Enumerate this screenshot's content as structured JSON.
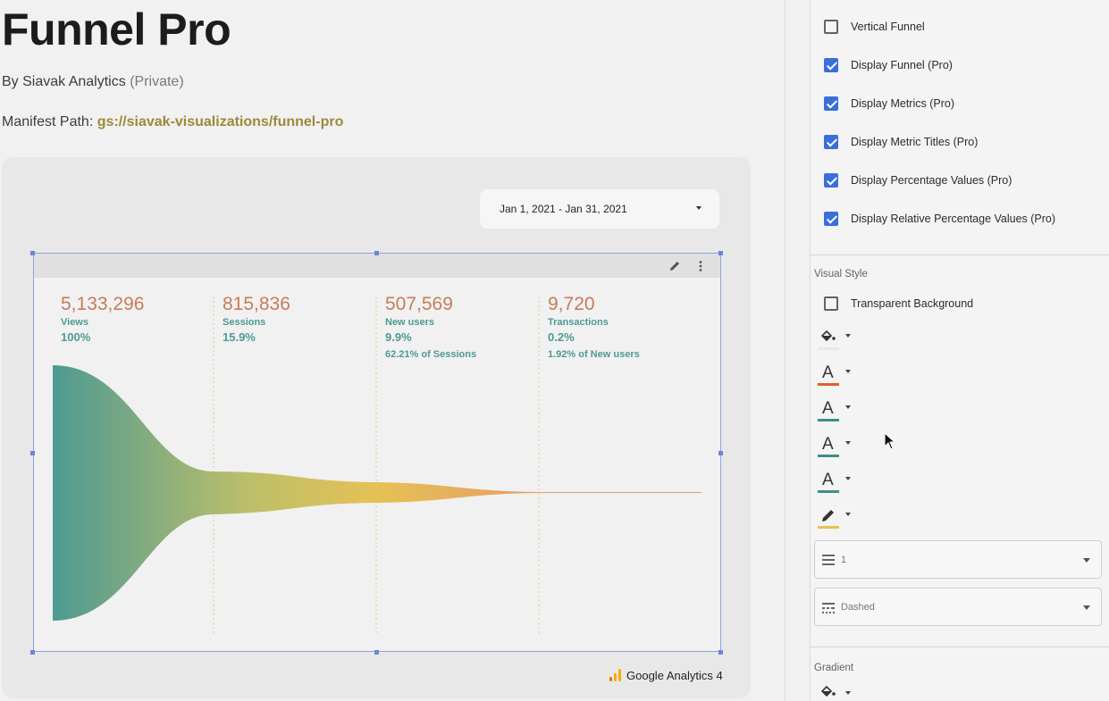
{
  "page": {
    "title": "Funnel Pro",
    "byline_prefix": "By Siavak Analytics",
    "byline_visibility": "(Private)",
    "manifest_label": "Manifest Path:",
    "manifest_path": "gs://siavak-visualizations/funnel-pro"
  },
  "preview": {
    "date_range": "Jan 1, 2021 - Jan 31, 2021",
    "data_source": "Google Analytics 4",
    "metrics": [
      {
        "value": "5,133,296",
        "label": "Views",
        "percent": "100%",
        "relative": ""
      },
      {
        "value": "815,836",
        "label": "Sessions",
        "percent": "15.9%",
        "relative": ""
      },
      {
        "value": "507,569",
        "label": "New users",
        "percent": "9.9%",
        "relative": "62.21% of Sessions"
      },
      {
        "value": "9,720",
        "label": "Transactions",
        "percent": "0.2%",
        "relative": "1.92% of New users"
      }
    ],
    "colors": {
      "teal": "#4e9a92",
      "gold": "#e6c155",
      "orange": "#e7a063",
      "value_text": "#c67d5a"
    }
  },
  "settings": {
    "checkboxes": [
      {
        "label": "Vertical Funnel",
        "checked": false
      },
      {
        "label": "Display Funnel (Pro)",
        "checked": true
      },
      {
        "label": "Display Metrics (Pro)",
        "checked": true
      },
      {
        "label": "Display Metric Titles (Pro)",
        "checked": true
      },
      {
        "label": "Display Percentage Values (Pro)",
        "checked": true
      },
      {
        "label": "Display Relative Percentage Values (Pro)",
        "checked": true
      }
    ],
    "visual_style_title": "Visual Style",
    "transparent_background": {
      "label": "Transparent Background",
      "checked": false
    },
    "style_tools": [
      {
        "icon": "fill-color-icon",
        "color": "#e8e8e8"
      },
      {
        "icon": "font-color-icon",
        "color": "#d9622b"
      },
      {
        "icon": "font-color-icon",
        "color": "#3e8e86"
      },
      {
        "icon": "font-color-icon",
        "color": "#3e8e86"
      },
      {
        "icon": "font-color-icon",
        "color": "#3e8e86"
      },
      {
        "icon": "line-color-icon",
        "color": "#e6c155"
      }
    ],
    "line_weight": "1",
    "line_type": "Dashed",
    "gradient_title": "Gradient"
  }
}
